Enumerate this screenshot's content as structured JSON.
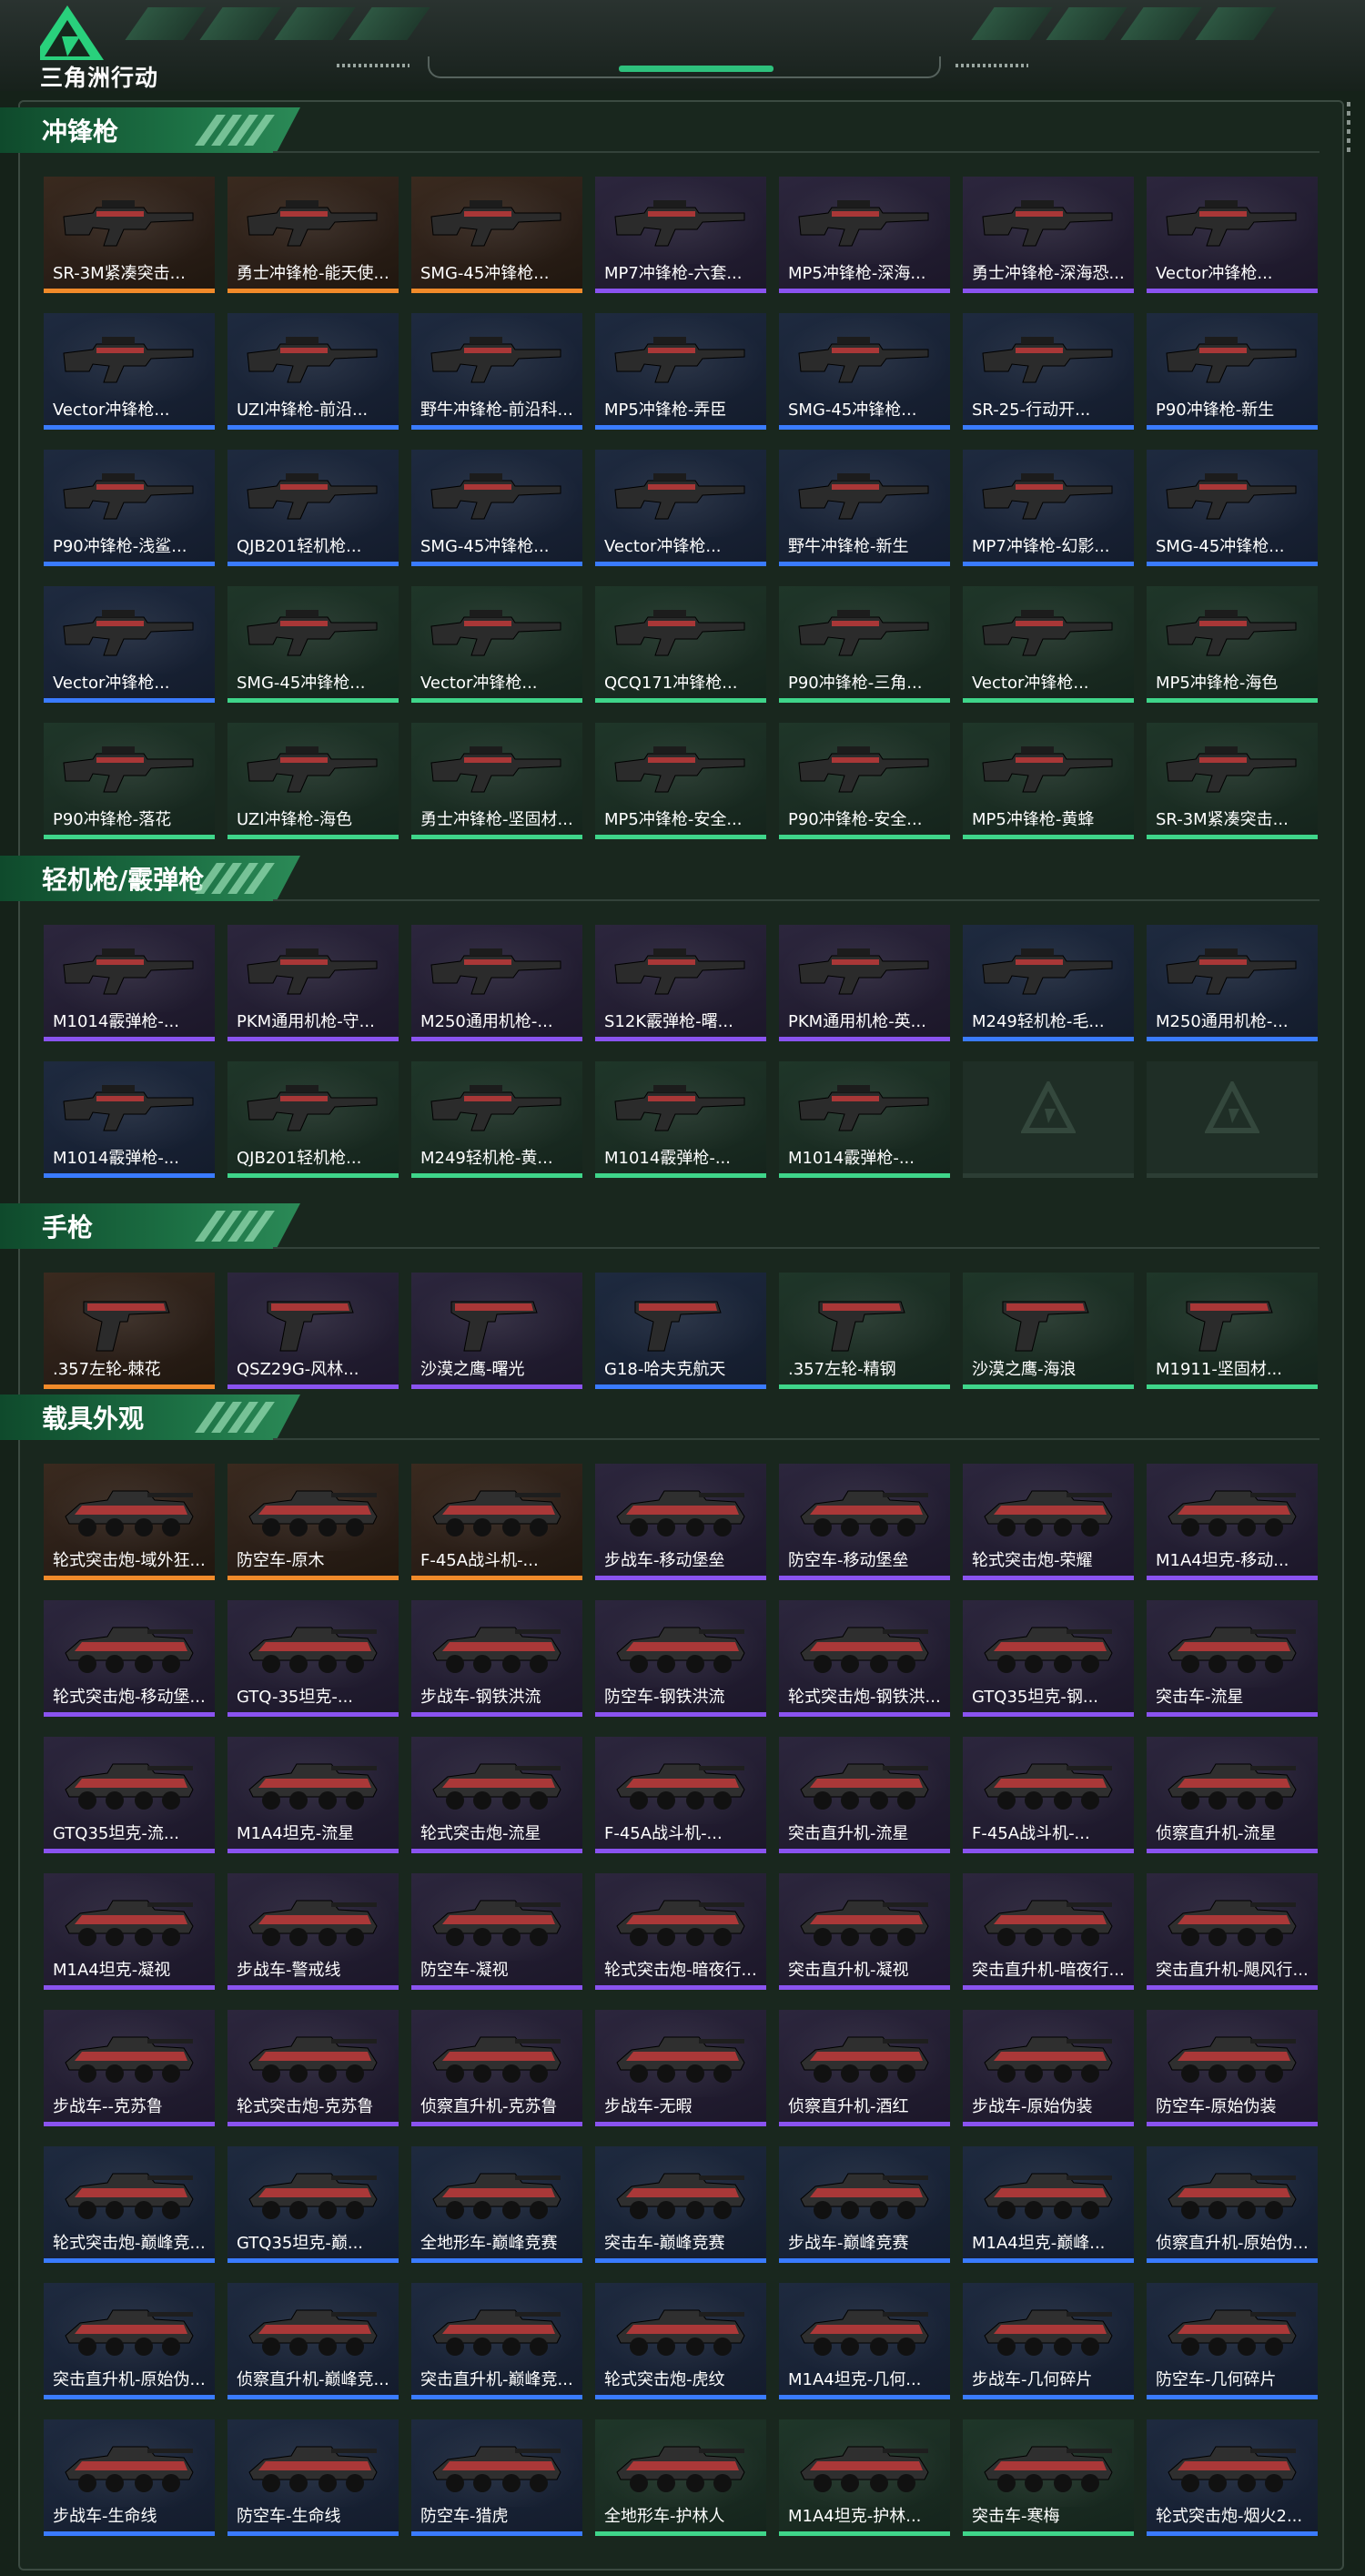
{
  "app": {
    "logo_text": "三角洲行动"
  },
  "colors": {
    "orange": "#f08a2a",
    "purple": "#8a53f0",
    "blue": "#3a7bff",
    "green": "#3fd58a"
  },
  "sections": [
    {
      "title": "冲锋枪",
      "type": "gun",
      "items": [
        {
          "label": "SR-3M紧凑突击...",
          "rarity": "orange"
        },
        {
          "label": "勇士冲锋枪-能天使...",
          "rarity": "orange"
        },
        {
          "label": "SMG-45冲锋枪...",
          "rarity": "orange"
        },
        {
          "label": "MP7冲锋枪-六套...",
          "rarity": "purple"
        },
        {
          "label": "MP5冲锋枪-深海...",
          "rarity": "purple"
        },
        {
          "label": "勇士冲锋枪-深海恐...",
          "rarity": "purple"
        },
        {
          "label": "Vector冲锋枪...",
          "rarity": "purple"
        },
        {
          "label": "Vector冲锋枪...",
          "rarity": "blue"
        },
        {
          "label": "UZI冲锋枪-前沿...",
          "rarity": "blue"
        },
        {
          "label": "野牛冲锋枪-前沿科...",
          "rarity": "blue"
        },
        {
          "label": "MP5冲锋枪-弄臣",
          "rarity": "blue"
        },
        {
          "label": "SMG-45冲锋枪...",
          "rarity": "blue"
        },
        {
          "label": "SR-25-行动开...",
          "rarity": "blue"
        },
        {
          "label": "P90冲锋枪-新生",
          "rarity": "blue"
        },
        {
          "label": "P90冲锋枪-浅鲨...",
          "rarity": "blue"
        },
        {
          "label": "QJB201轻机枪...",
          "rarity": "blue"
        },
        {
          "label": "SMG-45冲锋枪...",
          "rarity": "blue"
        },
        {
          "label": "Vector冲锋枪...",
          "rarity": "blue"
        },
        {
          "label": "野牛冲锋枪-新生",
          "rarity": "blue"
        },
        {
          "label": "MP7冲锋枪-幻影...",
          "rarity": "blue"
        },
        {
          "label": "SMG-45冲锋枪...",
          "rarity": "blue"
        },
        {
          "label": "Vector冲锋枪...",
          "rarity": "blue"
        },
        {
          "label": "SMG-45冲锋枪...",
          "rarity": "green"
        },
        {
          "label": "Vector冲锋枪...",
          "rarity": "green"
        },
        {
          "label": "QCQ171冲锋枪...",
          "rarity": "green"
        },
        {
          "label": "P90冲锋枪-三角...",
          "rarity": "green"
        },
        {
          "label": "Vector冲锋枪...",
          "rarity": "green"
        },
        {
          "label": "MP5冲锋枪-海色",
          "rarity": "green"
        },
        {
          "label": "P90冲锋枪-落花",
          "rarity": "green"
        },
        {
          "label": "UZI冲锋枪-海色",
          "rarity": "green"
        },
        {
          "label": "勇士冲锋枪-坚固材...",
          "rarity": "green"
        },
        {
          "label": "MP5冲锋枪-安全...",
          "rarity": "green"
        },
        {
          "label": "P90冲锋枪-安全...",
          "rarity": "green"
        },
        {
          "label": "MP5冲锋枪-黄蜂",
          "rarity": "green"
        },
        {
          "label": "SR-3M紧凑突击...",
          "rarity": "green"
        }
      ]
    },
    {
      "title": "轻机枪/霰弹枪",
      "type": "gun",
      "items": [
        {
          "label": "M1014霰弹枪-...",
          "rarity": "purple"
        },
        {
          "label": "PKM通用机枪-守...",
          "rarity": "purple"
        },
        {
          "label": "M250通用机枪-...",
          "rarity": "purple"
        },
        {
          "label": "S12K霰弹枪-曙...",
          "rarity": "purple"
        },
        {
          "label": "PKM通用机枪-英...",
          "rarity": "purple"
        },
        {
          "label": "M249轻机枪-毛...",
          "rarity": "blue"
        },
        {
          "label": "M250通用机枪-...",
          "rarity": "blue"
        },
        {
          "label": "M1014霰弹枪-...",
          "rarity": "blue"
        },
        {
          "label": "QJB201轻机枪...",
          "rarity": "green"
        },
        {
          "label": "M249轻机枪-黄...",
          "rarity": "green"
        },
        {
          "label": "M1014霰弹枪-...",
          "rarity": "green"
        },
        {
          "label": "M1014霰弹枪-...",
          "rarity": "green"
        },
        {
          "label": "",
          "rarity": "empty"
        },
        {
          "label": "",
          "rarity": "empty"
        }
      ]
    },
    {
      "title": "手枪",
      "type": "pistol",
      "items": [
        {
          "label": ".357左轮-棘花",
          "rarity": "orange"
        },
        {
          "label": "QSZ29G-风林...",
          "rarity": "purple"
        },
        {
          "label": "沙漠之鹰-曙光",
          "rarity": "purple"
        },
        {
          "label": "G18-哈夫克航天",
          "rarity": "blue"
        },
        {
          "label": ".357左轮-精钢",
          "rarity": "green"
        },
        {
          "label": "沙漠之鹰-海浪",
          "rarity": "green"
        },
        {
          "label": "M1911-坚固材...",
          "rarity": "green"
        }
      ]
    },
    {
      "title": "载具外观",
      "type": "vehicle",
      "items": [
        {
          "label": "轮式突击炮-域外狂...",
          "rarity": "orange"
        },
        {
          "label": "防空车-原木",
          "rarity": "orange"
        },
        {
          "label": "F-45A战斗机-...",
          "rarity": "orange"
        },
        {
          "label": "步战车-移动堡垒",
          "rarity": "purple"
        },
        {
          "label": "防空车-移动堡垒",
          "rarity": "purple"
        },
        {
          "label": "轮式突击炮-荣耀",
          "rarity": "purple"
        },
        {
          "label": "M1A4坦克-移动...",
          "rarity": "purple"
        },
        {
          "label": "轮式突击炮-移动堡...",
          "rarity": "purple"
        },
        {
          "label": "GTQ-35坦克-...",
          "rarity": "purple"
        },
        {
          "label": "步战车-钢铁洪流",
          "rarity": "purple"
        },
        {
          "label": "防空车-钢铁洪流",
          "rarity": "purple"
        },
        {
          "label": "轮式突击炮-钢铁洪...",
          "rarity": "purple"
        },
        {
          "label": "GTQ35坦克-钢...",
          "rarity": "purple"
        },
        {
          "label": "突击车-流星",
          "rarity": "purple"
        },
        {
          "label": "GTQ35坦克-流...",
          "rarity": "purple"
        },
        {
          "label": "M1A4坦克-流星",
          "rarity": "purple"
        },
        {
          "label": "轮式突击炮-流星",
          "rarity": "purple"
        },
        {
          "label": "F-45A战斗机-...",
          "rarity": "purple"
        },
        {
          "label": "突击直升机-流星",
          "rarity": "purple"
        },
        {
          "label": "F-45A战斗机-...",
          "rarity": "purple"
        },
        {
          "label": "侦察直升机-流星",
          "rarity": "purple"
        },
        {
          "label": "M1A4坦克-凝视",
          "rarity": "purple"
        },
        {
          "label": "步战车-警戒线",
          "rarity": "purple"
        },
        {
          "label": "防空车-凝视",
          "rarity": "purple"
        },
        {
          "label": "轮式突击炮-暗夜行...",
          "rarity": "purple"
        },
        {
          "label": "突击直升机-凝视",
          "rarity": "purple"
        },
        {
          "label": "突击直升机-暗夜行...",
          "rarity": "purple"
        },
        {
          "label": "突击直升机-飓风行...",
          "rarity": "purple"
        },
        {
          "label": "步战车--克苏鲁",
          "rarity": "purple"
        },
        {
          "label": "轮式突击炮-克苏鲁",
          "rarity": "purple"
        },
        {
          "label": "侦察直升机-克苏鲁",
          "rarity": "purple"
        },
        {
          "label": "步战车-无暇",
          "rarity": "purple"
        },
        {
          "label": "侦察直升机-酒红",
          "rarity": "purple"
        },
        {
          "label": "步战车-原始伪装",
          "rarity": "purple"
        },
        {
          "label": "防空车-原始伪装",
          "rarity": "purple"
        },
        {
          "label": "轮式突击炮-巅峰竞...",
          "rarity": "blue"
        },
        {
          "label": "GTQ35坦克-巅...",
          "rarity": "blue"
        },
        {
          "label": "全地形车-巅峰竞赛",
          "rarity": "blue"
        },
        {
          "label": "突击车-巅峰竞赛",
          "rarity": "blue"
        },
        {
          "label": "步战车-巅峰竞赛",
          "rarity": "blue"
        },
        {
          "label": "M1A4坦克-巅峰...",
          "rarity": "blue"
        },
        {
          "label": "侦察直升机-原始伪...",
          "rarity": "blue"
        },
        {
          "label": "突击直升机-原始伪...",
          "rarity": "blue"
        },
        {
          "label": "侦察直升机-巅峰竞...",
          "rarity": "blue"
        },
        {
          "label": "突击直升机-巅峰竞...",
          "rarity": "blue"
        },
        {
          "label": "轮式突击炮-虎纹",
          "rarity": "blue"
        },
        {
          "label": "M1A4坦克-几何...",
          "rarity": "blue"
        },
        {
          "label": "步战车-几何碎片",
          "rarity": "blue"
        },
        {
          "label": "防空车-几何碎片",
          "rarity": "blue"
        },
        {
          "label": "步战车-生命线",
          "rarity": "blue"
        },
        {
          "label": "防空车-生命线",
          "rarity": "blue"
        },
        {
          "label": "防空车-猎虎",
          "rarity": "blue"
        },
        {
          "label": "全地形车-护林人",
          "rarity": "green"
        },
        {
          "label": "M1A4坦克-护林...",
          "rarity": "green"
        },
        {
          "label": "突击车-寒梅",
          "rarity": "green"
        },
        {
          "label": "轮式突击炮-烟火2...",
          "rarity": "blue"
        }
      ]
    }
  ]
}
